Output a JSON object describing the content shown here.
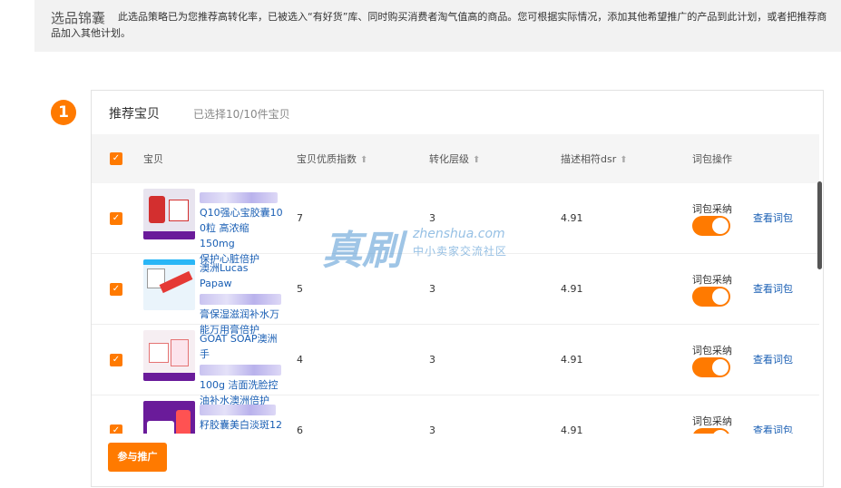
{
  "header": {
    "title": "选品锦囊",
    "description": "此选品策略已为您推荐高转化率，已被选入“有好货”库、同时购买消费者淘气值高的商品。您可根据实际情况，添加其他希望推广的产品到此计划，或者把推荐商品加入其他计划。"
  },
  "step": {
    "number": "1"
  },
  "card": {
    "title": "推荐宝贝",
    "subtitle": "已选择10/10件宝贝"
  },
  "table": {
    "columns": {
      "product": "宝贝",
      "quality_index": "宝贝优质指数",
      "conversion_level": "转化层级",
      "dsr": "描述相符dsr",
      "word_ops": "词包操作"
    },
    "rows": [
      {
        "title_lines": [
          "Q10强心宝胶囊10",
          "0粒 高浓缩150mg",
          "保护心脏倍护"
        ],
        "quality_index": "7",
        "conversion_level": "3",
        "dsr": "4.91",
        "op_label": "词包采纳",
        "view_link": "查看词包",
        "thumb_color": "#e8e4ef",
        "thumb_accent": "#d32f2f"
      },
      {
        "title_lines": [
          "澳洲Lucas Papaw",
          "膏保湿滋润补水万",
          "能万用膏倍护"
        ],
        "quality_index": "5",
        "conversion_level": "3",
        "dsr": "4.91",
        "op_label": "词包采纳",
        "view_link": "查看词包",
        "thumb_color": "#eaf4fb",
        "thumb_accent": "#e53935"
      },
      {
        "title_lines": [
          "GOAT SOAP澳洲手",
          "100g 洁面洗脸控",
          "油补水澳洲倍护"
        ],
        "quality_index": "4",
        "conversion_level": "3",
        "dsr": "4.91",
        "op_label": "词包采纳",
        "view_link": "查看词包",
        "thumb_color": "#f6eef2",
        "thumb_accent": "#e57373"
      },
      {
        "title_lines": [
          "籽胶囊美白淡斑12"
        ],
        "quality_index": "6",
        "conversion_level": "3",
        "dsr": "4.91",
        "op_label": "词包采纳",
        "view_link": "查看词包",
        "thumb_color": "#6a1b9a",
        "thumb_accent": "#ff5252"
      }
    ]
  },
  "buttons": {
    "join": "参与推广"
  },
  "watermark": {
    "big": "真刷",
    "url": "zhenshua.com",
    "cn": "中小卖家交流社区"
  },
  "colors": {
    "accent": "#ff7a00",
    "link": "#1a5fb4"
  }
}
